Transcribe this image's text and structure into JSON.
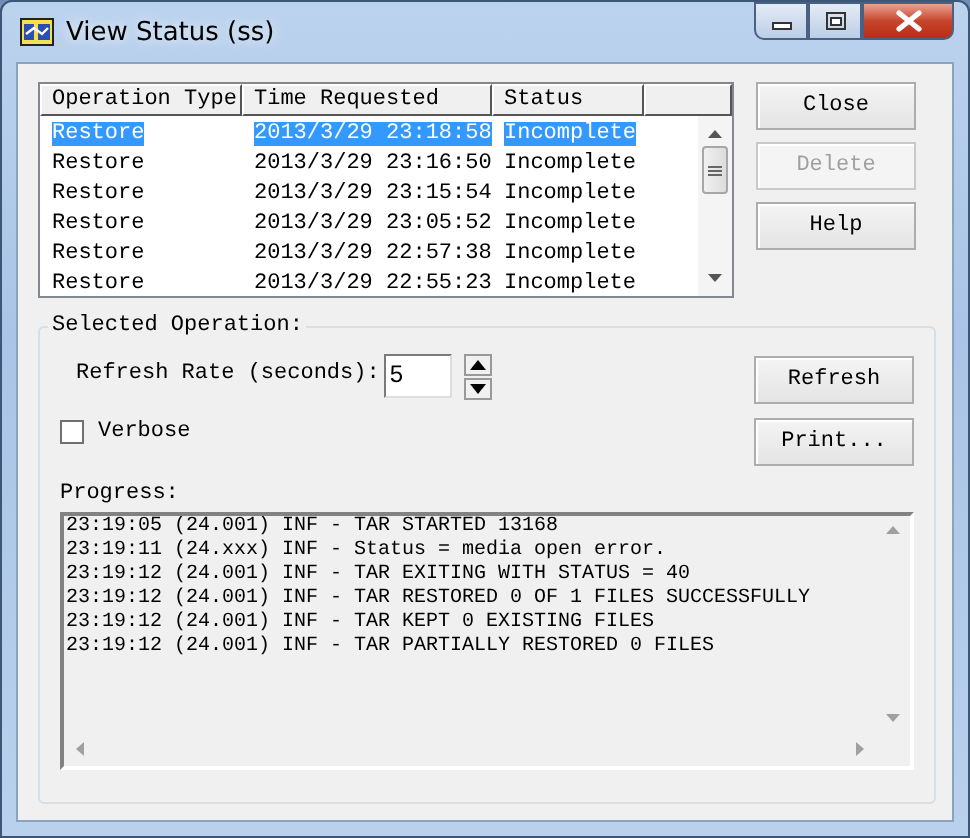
{
  "window": {
    "title": "View Status (ss)"
  },
  "operations": {
    "columns": [
      "Operation Type",
      "Time Requested",
      "Status"
    ],
    "rows": [
      {
        "operation_type": "Restore",
        "time_requested": "2013/3/29 23:18:58",
        "status": "Incomplete",
        "selected": true
      },
      {
        "operation_type": "Restore",
        "time_requested": "2013/3/29 23:16:50",
        "status": "Incomplete",
        "selected": false
      },
      {
        "operation_type": "Restore",
        "time_requested": "2013/3/29 23:15:54",
        "status": "Incomplete",
        "selected": false
      },
      {
        "operation_type": "Restore",
        "time_requested": "2013/3/29 23:05:52",
        "status": "Incomplete",
        "selected": false
      },
      {
        "operation_type": "Restore",
        "time_requested": "2013/3/29 22:57:38",
        "status": "Incomplete",
        "selected": false
      },
      {
        "operation_type": "Restore",
        "time_requested": "2013/3/29 22:55:23",
        "status": "Incomplete",
        "selected": false
      }
    ]
  },
  "side_buttons": [
    {
      "label": "Close",
      "disabled": false
    },
    {
      "label": "Delete",
      "disabled": true
    },
    {
      "label": "Help",
      "disabled": false
    }
  ],
  "selected_operation": {
    "title": "Selected Operation:",
    "refresh_rate": {
      "label": "Refresh Rate (seconds):",
      "value": "5"
    },
    "verbose": {
      "label": "Verbose",
      "checked": false
    },
    "buttons": [
      {
        "label": "Refresh"
      },
      {
        "label": "Print..."
      }
    ],
    "progress": {
      "label": "Progress:",
      "lines": [
        "23:19:05 (24.001) INF - TAR STARTED 13168",
        "23:19:11 (24.xxx) INF - Status = media open error.",
        "23:19:12 (24.001) INF - TAR EXITING WITH STATUS = 40",
        "23:19:12 (24.001) INF - TAR RESTORED 0 OF 1 FILES SUCCESSFULLY",
        "23:19:12 (24.001) INF - TAR KEPT 0 EXISTING FILES",
        "23:19:12 (24.001) INF - TAR PARTIALLY RESTORED 0 FILES"
      ]
    }
  }
}
